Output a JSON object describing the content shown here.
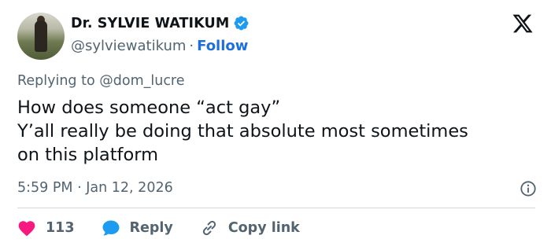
{
  "author": {
    "name": "Dr. SYLVIE WATIKUM",
    "handle": "@sylviewatikum",
    "separator": "·",
    "follow_label": "Follow"
  },
  "reply_context": {
    "prefix": "Replying to",
    "mention": "@dom_lucre"
  },
  "tweet": {
    "lines": [
      "How does someone “act gay”",
      "Y’all really be doing that absolute most sometimes",
      "on this platform"
    ]
  },
  "meta": {
    "time": "5:59 PM",
    "separator": "·",
    "date": "Jan 12, 2026"
  },
  "actions": {
    "like_count": "113",
    "reply_label": "Reply",
    "copy_link_label": "Copy link"
  },
  "icons": {
    "verified": "verified-badge-icon",
    "platform": "x-logo-icon",
    "info": "info-icon",
    "like": "heart-icon",
    "reply": "chat-bubble-icon",
    "copy": "link-icon"
  },
  "colors": {
    "accent": "#1d9bf0",
    "follow": "#1d6fe0",
    "like": "#f91880",
    "muted": "#536471",
    "text": "#0f1419"
  }
}
